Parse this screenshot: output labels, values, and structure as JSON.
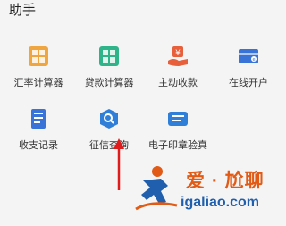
{
  "header": {
    "title": "助手"
  },
  "tools": [
    {
      "label": "汇率计算器",
      "icon": "exchange-calculator-icon",
      "color": "#f0a640"
    },
    {
      "label": "贷款计算器",
      "icon": "loan-calculator-icon",
      "color": "#2fb48a"
    },
    {
      "label": "主动收款",
      "icon": "collect-money-icon",
      "color": "#e85f3b"
    },
    {
      "label": "在线开户",
      "icon": "open-account-icon",
      "color": "#3a73d8"
    },
    {
      "label": "收支记录",
      "icon": "records-icon",
      "color": "#3a73d8"
    },
    {
      "label": "征信查询",
      "icon": "credit-check-icon",
      "color": "#2f7fd8"
    },
    {
      "label": "电子印章验真",
      "icon": "e-seal-verify-icon",
      "color": "#2f7fd8"
    }
  ],
  "watermark": {
    "brand_cn": "爱 · 尬聊",
    "domain": "igaliao.com",
    "colors": {
      "cn": "#e25b16",
      "en": "#1f5fae"
    }
  }
}
